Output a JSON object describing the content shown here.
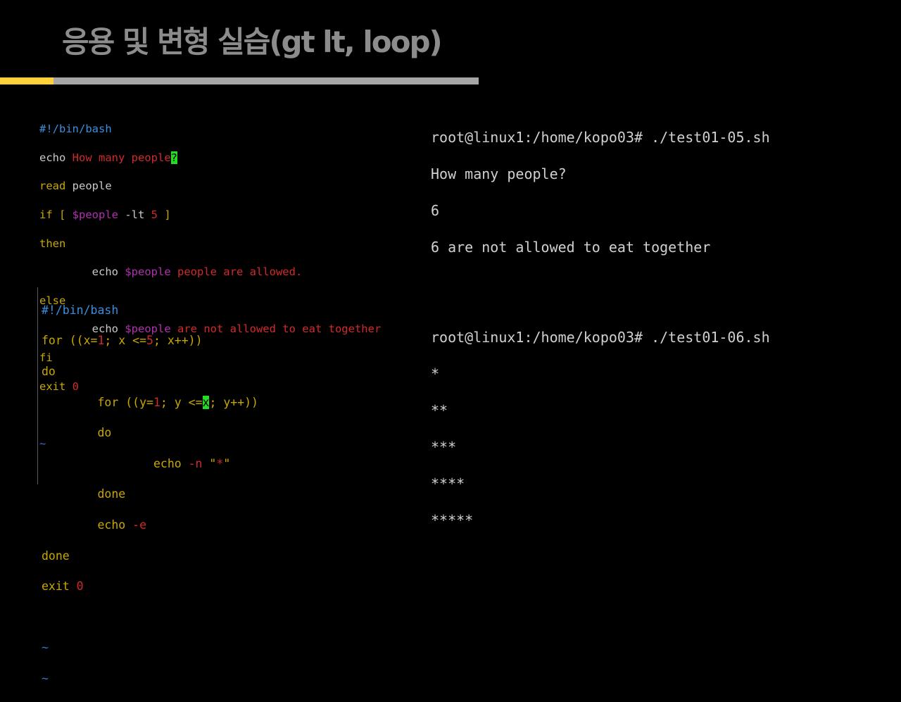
{
  "slide": {
    "title": "응용 및 변형 실습(gt lt, loop)"
  },
  "script1": {
    "shebang": "#!/bin/bash",
    "echo": "echo",
    "prompt_text": "How many people",
    "cursor_char": "?",
    "read": "read",
    "read_var": "people",
    "if_open": "if [ ",
    "var_people": "$people",
    "op_lt": " -lt ",
    "num_5": "5",
    "if_close": " ]",
    "then": "then",
    "indent": "        ",
    "allowed_text": " people are allowed.",
    "else": "else",
    "not_allowed_text": " are not allowed to eat together",
    "fi": "fi",
    "exit": "exit",
    "exit_code": "0",
    "tilde": "~"
  },
  "script2": {
    "shebang": "#!/bin/bash",
    "for_outer_a": "for ((x=",
    "for_outer_n1": "1",
    "for_outer_b": "; x <=",
    "for_outer_n5": "5",
    "for_outer_c": "; x++))",
    "do": "do",
    "indent1": "        ",
    "indent2": "                ",
    "for_inner_a": "for ((y=",
    "for_inner_n1": "1",
    "for_inner_b": "; y <=",
    "for_inner_cursor": "x",
    "for_inner_c": "; y++))",
    "echo_n": "echo ",
    "flag_n": "-n",
    "quote_open": " \"",
    "star": "*",
    "quote_close": "\"",
    "done": "done",
    "echo_e": "echo ",
    "flag_e": "-e",
    "exit": "exit ",
    "exit_code": "0",
    "tilde": "~"
  },
  "terminal1": {
    "lines": [
      "root@linux1:/home/kopo03# ./test01-05.sh",
      "How many people?",
      "6",
      "6 are not allowed to eat together"
    ]
  },
  "terminal2": {
    "lines": [
      "root@linux1:/home/kopo03# ./test01-06.sh",
      "*",
      "**",
      "***",
      "****",
      "*****"
    ]
  },
  "colors": {
    "background": "#000000",
    "title": "#8c8c8c",
    "accent_bar": "#ffd23c",
    "divider_bar": "#a6a6a6",
    "comment": "#3a8fde",
    "keyword": "#c8a800",
    "string": "#d22a2a",
    "variable": "#b030b0",
    "cursor": "#22dd22"
  }
}
